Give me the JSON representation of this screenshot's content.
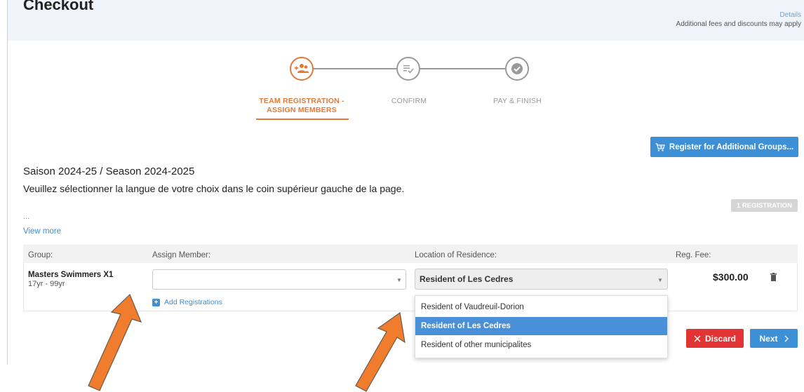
{
  "header": {
    "title": "Checkout",
    "details_link": "Details",
    "fees_note": "Additional fees and discounts may apply"
  },
  "stepper": {
    "steps": [
      {
        "label": "TEAM REGISTRATION - ASSIGN MEMBERS",
        "state": "active"
      },
      {
        "label": "CONFIRM",
        "state": "pending"
      },
      {
        "label": "PAY & FINISH",
        "state": "pending"
      }
    ]
  },
  "actions": {
    "register_additional": "Register for Additional Groups..."
  },
  "season": {
    "title": "Saison 2024-25 / Season 2024-2025",
    "description": "Veuillez sélectionner la langue de votre choix dans le coin supérieur gauche de la page.",
    "ellipsis": "...",
    "view_more": "View more",
    "registration_count": "1 REGISTRATION"
  },
  "table": {
    "headers": {
      "group": "Group:",
      "member": "Assign Member:",
      "location": "Location of Residence:",
      "fee": "Reg. Fee:"
    },
    "row": {
      "group_name": "Masters Swimmers X1",
      "group_age": "17yr - 99yr",
      "member_value": "",
      "add_registrations": "Add Registrations",
      "location_value": "Resident of Les Cedres",
      "fee": "$300.00"
    }
  },
  "location_dropdown": {
    "options": [
      "Resident of Vaudreuil-Dorion",
      "Resident of Les Cedres",
      "Resident of other municipalites"
    ],
    "selected": "Resident of Les Cedres"
  },
  "footer": {
    "discard": "Discard",
    "next": "Next"
  },
  "colors": {
    "accent_orange": "#e07a3a",
    "primary_blue": "#3d8fd6",
    "danger_red": "#e23434",
    "annotation_arrow": "#f07c2e"
  }
}
